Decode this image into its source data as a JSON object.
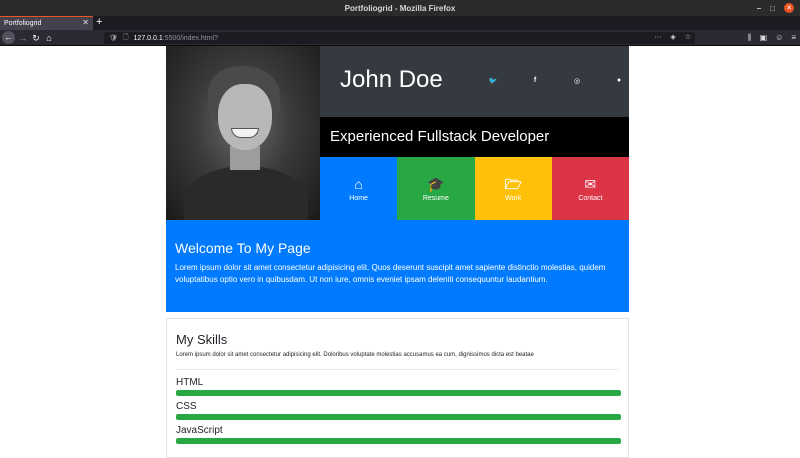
{
  "window": {
    "title": "Portfoliogrid - Mozilla Firefox",
    "minimize": "–",
    "maximize": "□",
    "close": "✕"
  },
  "tabs": [
    {
      "label": "Portfoliogrid",
      "close": "✕"
    }
  ],
  "new_tab": "+",
  "nav": {
    "back": "←",
    "forward": "→",
    "reload": "↻",
    "home": "⌂",
    "url_host": "127.0.0.1",
    "url_rest": ":5500/index.html?",
    "url_actions": [
      "···",
      "◈",
      "☆"
    ],
    "tools": [
      "⫼",
      "▣",
      "☺",
      "≡"
    ]
  },
  "profile": {
    "name": "John Doe",
    "tagline": "Experienced Fullstack Developer",
    "socials": [
      {
        "icon": "twitter-icon",
        "glyph": "🐦"
      },
      {
        "icon": "facebook-icon",
        "glyph": "f"
      },
      {
        "icon": "instagram-icon",
        "glyph": "◎"
      },
      {
        "icon": "github-icon",
        "glyph": "●"
      }
    ]
  },
  "tiles": [
    {
      "key": "home",
      "icon": "home-icon",
      "glyph": "⌂",
      "label": "Home",
      "color": "#007bff"
    },
    {
      "key": "resume",
      "icon": "graduation-cap-icon",
      "glyph": "🎓",
      "label": "Resume",
      "color": "#28a745"
    },
    {
      "key": "work",
      "icon": "folder-open-icon",
      "glyph": "🗁",
      "label": "Work",
      "color": "#ffc107"
    },
    {
      "key": "contact",
      "icon": "envelope-icon",
      "glyph": "✉",
      "label": "Contact",
      "color": "#dc3545"
    }
  ],
  "welcome": {
    "heading": "Welcome To My Page",
    "text": "Lorem ipsum dolor sit amet consectetur adipisicing elit. Quos deserunt suscipit amet sapiente distinctio molestias, quidem voluptatibus optio vero in quibusdam. Ut non iure, omnis eveniet ipsam deleniti consequuntur laudantium."
  },
  "skills": {
    "heading": "My Skills",
    "description": "Lorem ipsum dolor sit amet consectetur adipisicing elit. Doloribus voluptate molestias accusamus ea cum, dignissimos dicta est beatae",
    "items": [
      {
        "name": "HTML",
        "level": 1.0
      },
      {
        "name": "CSS",
        "level": 1.0
      },
      {
        "name": "JavaScript",
        "level": 1.0
      }
    ]
  }
}
